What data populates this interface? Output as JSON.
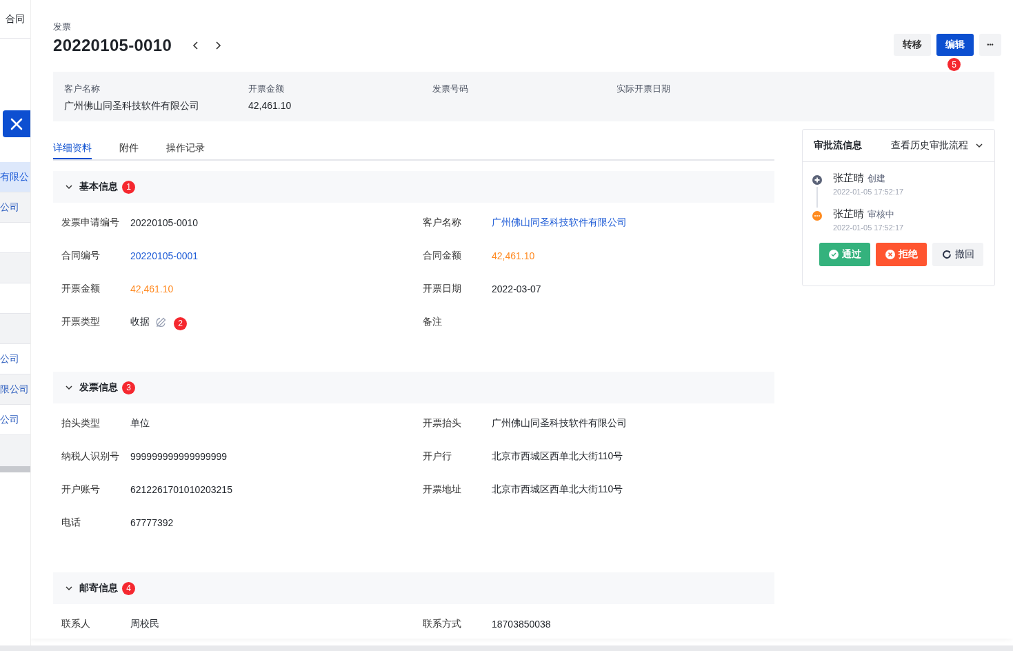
{
  "background_list": {
    "header": "合同",
    "rows": [
      {
        "text": "有限公",
        "selected": true
      },
      {
        "text": "公司",
        "selected": false
      },
      {
        "selected": false
      },
      {
        "selected": false
      },
      {
        "selected": false
      },
      {
        "selected": false
      },
      {
        "text": "公司",
        "selected": false
      },
      {
        "text": "限公司",
        "selected": false
      },
      {
        "text": "公司",
        "selected": false
      },
      {
        "selected": false
      }
    ]
  },
  "header": {
    "subtitle": "发票",
    "title": "20220105-0010",
    "actions": [
      {
        "label": "转移",
        "kind": "default"
      },
      {
        "label": "编辑",
        "kind": "primary",
        "marker": "5"
      },
      {
        "label": "•••",
        "kind": "more"
      }
    ]
  },
  "summary": [
    {
      "label": "客户名称",
      "value": "广州佛山同圣科技软件有限公司"
    },
    {
      "label": "开票金额",
      "value": "42,461.10"
    },
    {
      "label": "发票号码"
    },
    {
      "label": "实际开票日期"
    }
  ],
  "tabs": [
    {
      "label": "详细资料",
      "selected": true
    },
    {
      "label": "附件",
      "selected": false
    },
    {
      "label": "操作记录",
      "selected": false
    }
  ],
  "sections": [
    {
      "title": "基本信息",
      "marker": "1",
      "expanded": true,
      "fields": [
        {
          "label": "发票申请编号",
          "value": "20220105-0010",
          "kind": "text"
        },
        {
          "label": "客户名称",
          "value": "广州佛山同圣科技软件有限公司",
          "kind": "link"
        },
        {
          "label": "合同编号",
          "value": "20220105-0001",
          "kind": "link"
        },
        {
          "label": "合同金额",
          "value": "42,461.10",
          "kind": "amount"
        },
        {
          "label": "开票金额",
          "value": "42,461.10",
          "kind": "amount"
        },
        {
          "label": "开票日期",
          "value": "2022-03-07",
          "kind": "text"
        },
        {
          "label": "开票类型",
          "value": "收据",
          "kind": "text",
          "editable": true,
          "marker": "2"
        },
        {
          "label": "备注"
        }
      ]
    },
    {
      "title": "发票信息",
      "marker": "3",
      "expanded": true,
      "fields": [
        {
          "label": "抬头类型",
          "value": "单位",
          "kind": "text"
        },
        {
          "label": "开票抬头",
          "value": "广州佛山同圣科技软件有限公司",
          "kind": "text"
        },
        {
          "label": "纳税人识别号",
          "value": "999999999999999999",
          "kind": "text"
        },
        {
          "label": "开户行",
          "value": "北京市西城区西单北大街110号",
          "kind": "text"
        },
        {
          "label": "开户账号",
          "value": "6212261701010203215",
          "kind": "text"
        },
        {
          "label": "开票地址",
          "value": "北京市西城区西单北大街110号",
          "kind": "text"
        },
        {
          "label": "电话",
          "value": "67777392",
          "kind": "text"
        }
      ]
    },
    {
      "title": "邮寄信息",
      "marker": "4",
      "expanded": true,
      "fields": [
        {
          "label": "联系人",
          "value": "周校民",
          "kind": "text"
        },
        {
          "label": "联系方式",
          "value": "18703850038",
          "kind": "text"
        }
      ]
    }
  ],
  "approval": {
    "title": "审批流信息",
    "history_link": "查看历史审批流程",
    "steps": [
      {
        "name": "张芷晴",
        "action": "创建",
        "time": "2022-01-05 17:52:17",
        "kind": "created"
      },
      {
        "name": "张芷晴",
        "action": "审核中",
        "time": "2022-01-05 17:52:17",
        "kind": "pending"
      }
    ],
    "buttons": [
      {
        "label": "通过",
        "kind": "approve"
      },
      {
        "label": "拒绝",
        "kind": "reject"
      },
      {
        "label": "撤回",
        "kind": "withdraw"
      }
    ]
  }
}
